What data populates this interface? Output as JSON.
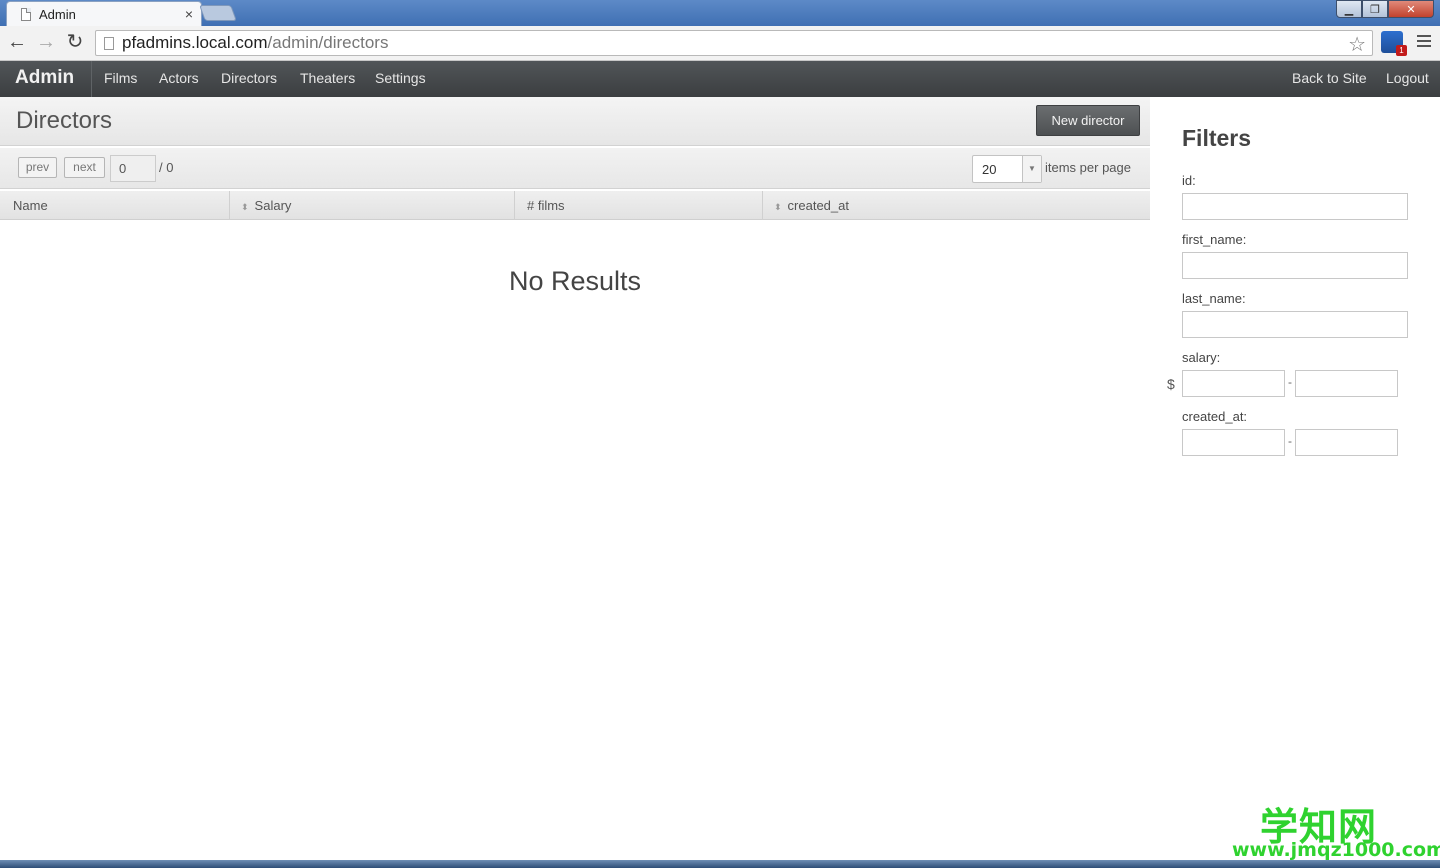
{
  "browser": {
    "tab_title": "Admin",
    "tab_close": "×",
    "url_host": "pfadmins.local.com",
    "url_path": "/admin/directors",
    "back": "←",
    "forward": "→",
    "reload": "↻",
    "star": "☆"
  },
  "nav": {
    "brand": "Admin",
    "links": [
      "Films",
      "Actors",
      "Directors",
      "Theaters",
      "Settings"
    ],
    "right_links": [
      "Back to Site",
      "Logout"
    ]
  },
  "main": {
    "title": "Directors",
    "new_button": "New director",
    "pager": {
      "prev": "prev",
      "next": "next",
      "page_value": "0",
      "total": "/ 0",
      "per_page_value": "20",
      "per_page_label": "items per page"
    },
    "columns": [
      "Name",
      "Salary",
      "# films",
      "created_at"
    ],
    "empty_message": "No Results"
  },
  "filters": {
    "title": "Filters",
    "fields": {
      "id": "id:",
      "first_name": "first_name:",
      "last_name": "last_name:",
      "salary": "salary:",
      "created_at": "created_at:"
    },
    "salary_prefix": "$",
    "range_sep": "-"
  },
  "watermark": {
    "main": "学知网",
    "url": "www.jmqz1000.com"
  },
  "colors": {
    "navbar": "#45484a",
    "accent_button": "#5c5f61",
    "watermark": "#2fd22f"
  }
}
